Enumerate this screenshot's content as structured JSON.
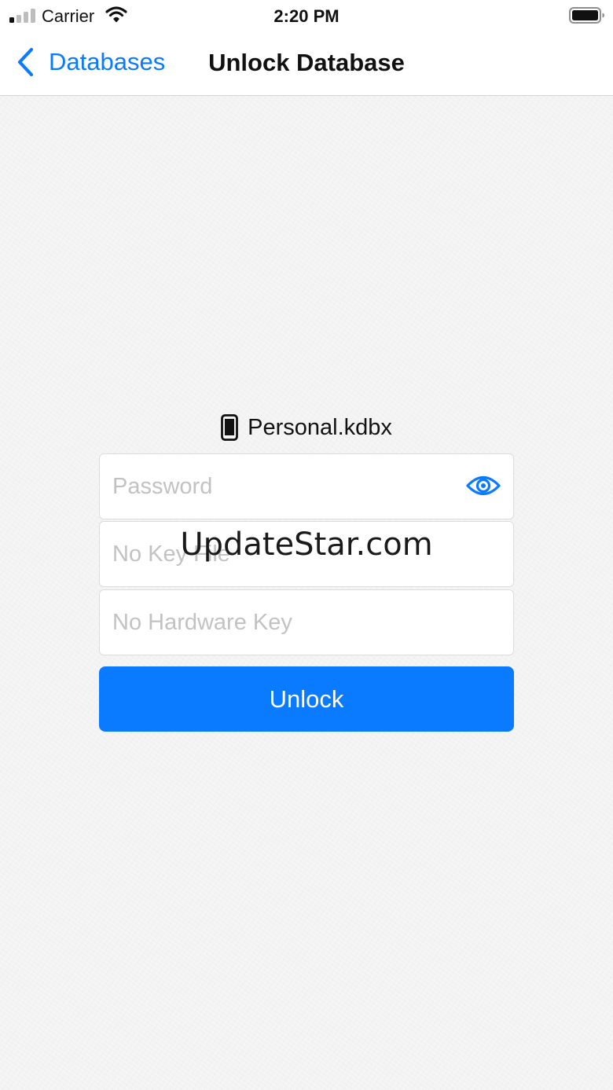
{
  "status_bar": {
    "carrier": "Carrier",
    "time": "2:20 PM",
    "signal_bars_filled": 1,
    "signal_bars_total": 4,
    "icons": [
      "signal-icon",
      "wifi-icon",
      "battery-icon"
    ]
  },
  "nav": {
    "back_label": "Databases",
    "title": "Unlock Database",
    "back_icon": "chevron-left-icon"
  },
  "database": {
    "name": "Personal.kdbx",
    "icon": "phone-icon"
  },
  "form": {
    "password_placeholder": "Password",
    "password_value": "",
    "show_password_icon": "eye-icon",
    "key_file_text": "No Key File",
    "hardware_key_text": "No Hardware Key",
    "unlock_label": "Unlock"
  },
  "watermark": "UpdateStar.com",
  "colors": {
    "accent": "#0a7aff",
    "background": "#f3f3f3",
    "placeholder": "#c2c2c2"
  }
}
